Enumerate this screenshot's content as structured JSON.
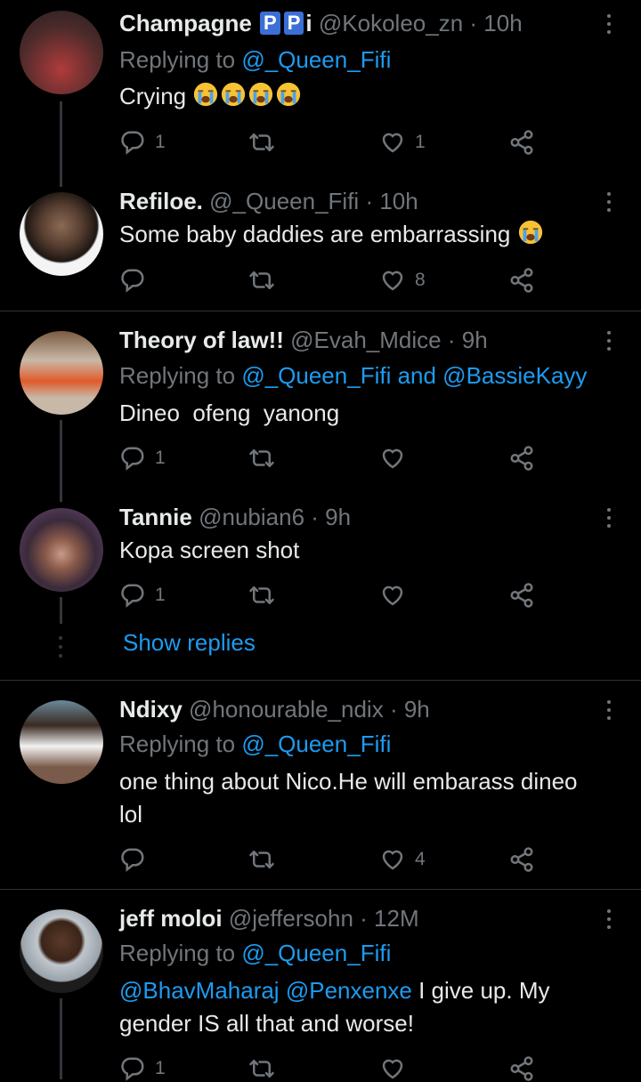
{
  "tweets": [
    {
      "name": "Champagne",
      "badges": [
        "P",
        "P"
      ],
      "badge_tail": "i",
      "handle": "@Kokoleo_zn",
      "time": "· 10h",
      "replying_prefix": "Replying to",
      "replying_to": "@_Queen_Fifi",
      "text": "Crying",
      "emoji_count": 4,
      "reply_count": "1",
      "retweet_count": "",
      "like_count": "1"
    },
    {
      "name": "Refiloe.",
      "handle": "@_Queen_Fifi",
      "time": "· 10h",
      "text": "Some baby daddies are embarrassing",
      "emoji_count": 1,
      "reply_count": "",
      "retweet_count": "",
      "like_count": "8"
    },
    {
      "name": "Theory of law!!",
      "handle": "@Evah_Mdice",
      "time": "· 9h",
      "replying_prefix": "Replying to",
      "replying_to": "@_Queen_Fifi and @BassieKayy",
      "text": "Dineo  ofeng  yanong",
      "reply_count": "1",
      "retweet_count": "",
      "like_count": ""
    },
    {
      "name": "Tannie",
      "handle": "@nubian6",
      "time": "· 9h",
      "text": "Kopa screen shot",
      "reply_count": "1",
      "retweet_count": "",
      "like_count": ""
    },
    {
      "name": "Ndixy",
      "handle": "@honourable_ndix",
      "time": "· 9h",
      "replying_prefix": "Replying to",
      "replying_to": "@_Queen_Fifi",
      "text_line1": "one thing about Nico.He will embarass dineo",
      "text_line2": "lol",
      "reply_count": "",
      "retweet_count": "",
      "like_count": "4"
    },
    {
      "name": "jeff moloi",
      "handle": "@jeffersohn",
      "time": "· 12M",
      "replying_prefix": "Replying to",
      "replying_to": "@_Queen_Fifi",
      "mention1": "@BhavMaharaj",
      "mention2": "@Penxenxe",
      "text_line1_rest": " I give up. My",
      "text_line2": "gender IS all that and worse!",
      "reply_count": "1",
      "retweet_count": "",
      "like_count": ""
    }
  ],
  "show_replies": "Show replies",
  "icons": {
    "reply": "reply-icon",
    "retweet": "retweet-icon",
    "like": "like-icon",
    "share": "share-icon",
    "more": "more-icon",
    "emoji": "crying-emoji-icon"
  },
  "colors": {
    "background": "#000000",
    "text": "#e7e9ea",
    "muted": "#71767b",
    "accent": "#1d9bf0",
    "divider": "#2f3336"
  }
}
